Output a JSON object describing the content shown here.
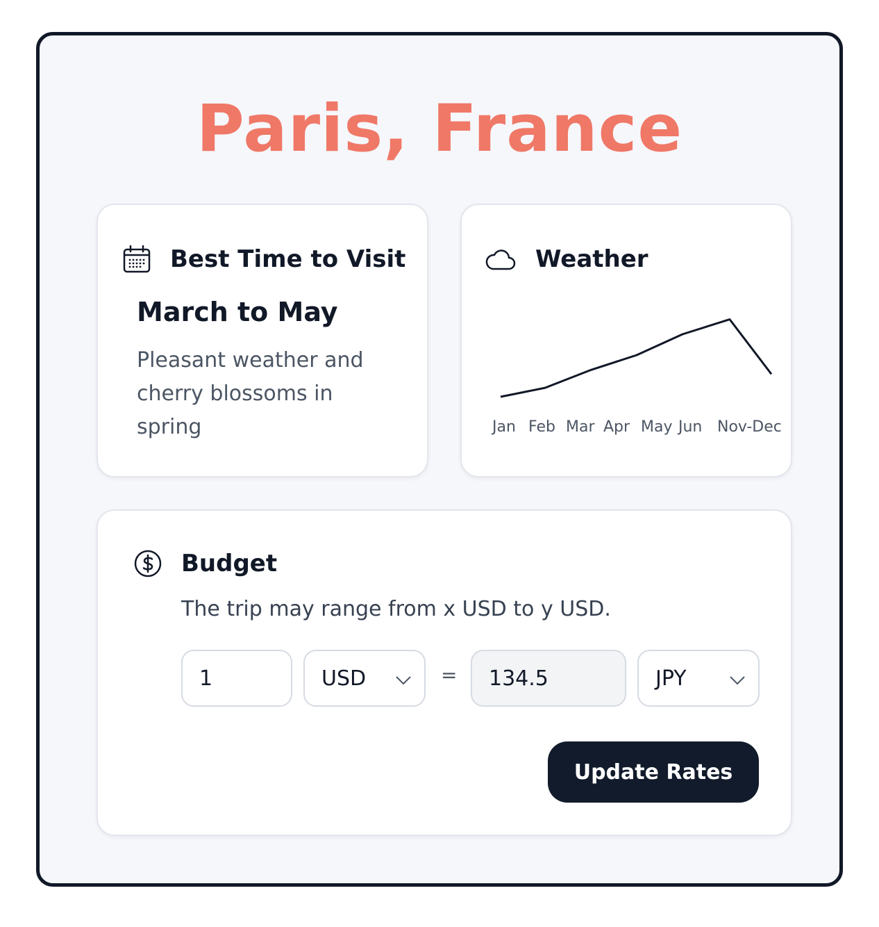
{
  "title": "Paris, France",
  "colors": {
    "accent": "#ef7867",
    "dark": "#111b2b",
    "card_border": "#e3e6ec"
  },
  "visit": {
    "icon": "calendar-icon",
    "title": "Best Time to Visit",
    "heading": "March to May",
    "description": "Pleasant weather and cherry blossoms in spring"
  },
  "weather": {
    "icon": "cloud-icon",
    "title": "Weather"
  },
  "chart_data": {
    "type": "line",
    "categories": [
      "Jan",
      "Feb",
      "Mar",
      "Apr",
      "May",
      "Jun",
      "Nov-Dec"
    ],
    "values": [
      0,
      1.5,
      4.5,
      7,
      10.5,
      13,
      3.8
    ],
    "ylim": [
      0,
      14
    ],
    "grid": false,
    "legend": "none",
    "axes_visible": false
  },
  "budget": {
    "icon": "dollar-circle-icon",
    "title": "Budget",
    "text": "The trip may range from x USD to y USD.",
    "amount": "1",
    "from_currency": "USD",
    "equals": "=",
    "result": "134.5",
    "to_currency": "JPY",
    "button": "Update Rates"
  }
}
